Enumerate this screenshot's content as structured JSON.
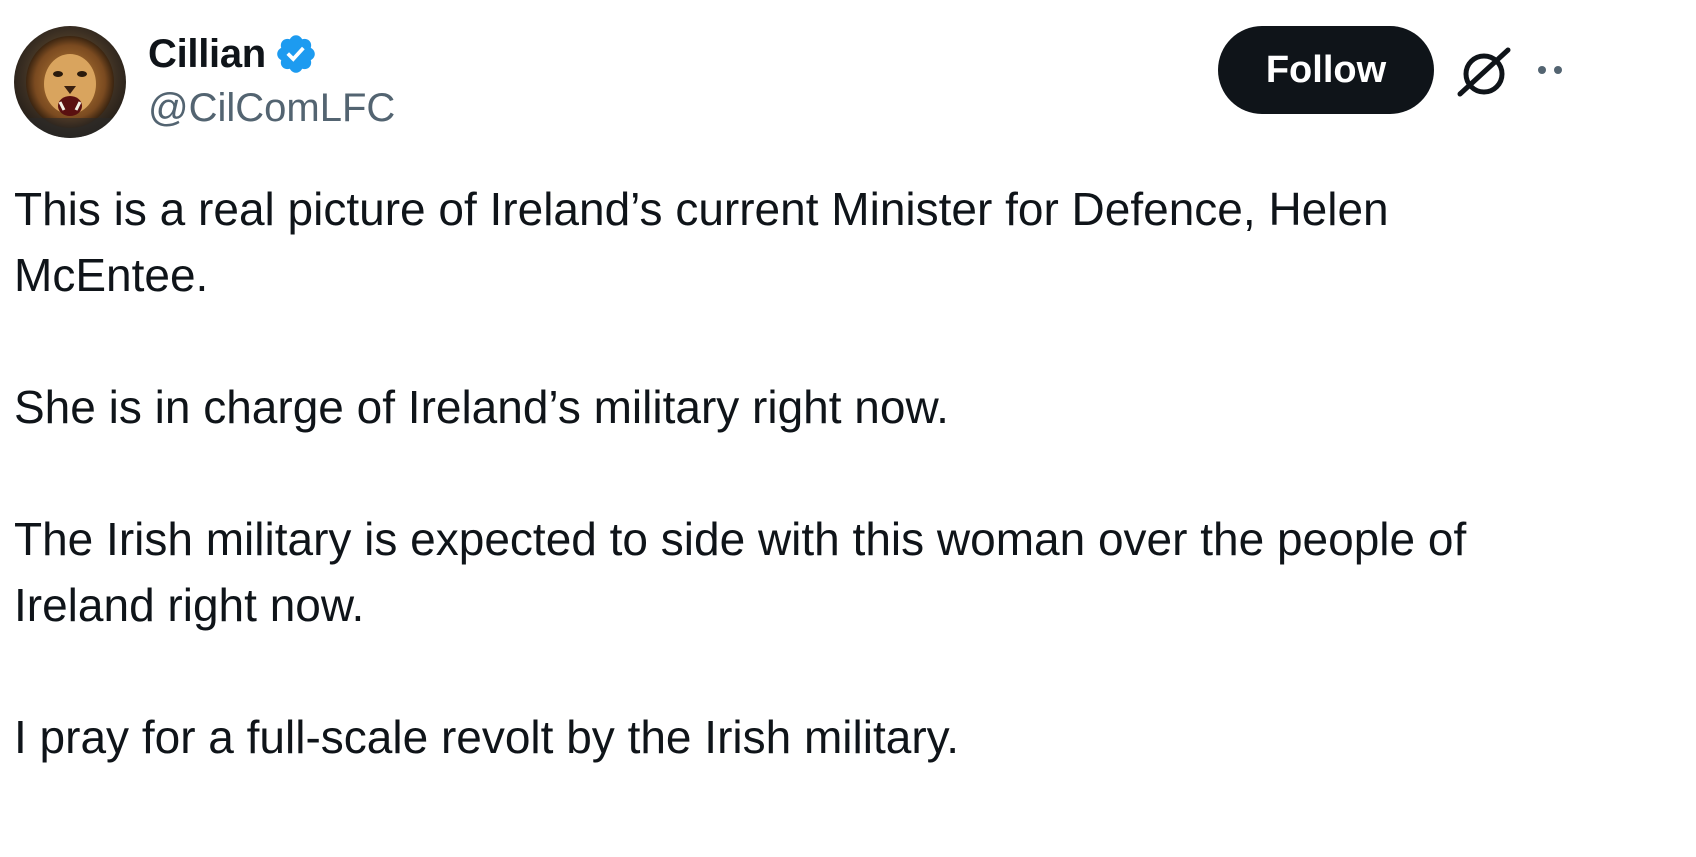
{
  "author": {
    "display_name": "Cillian",
    "handle": "@CilComLFC",
    "verified": true,
    "avatar_icon": "lion-avatar-icon",
    "verified_icon": "verified-badge-icon",
    "verified_color": "#1d9bf0"
  },
  "actions": {
    "follow_label": "Follow",
    "grok_icon": "grok-icon",
    "more_icon": "more-options-icon"
  },
  "post": {
    "paragraphs": [
      "This is a real picture of Ireland’s current Minister for Defence, Helen McEntee.",
      "She is in charge of Ireland’s military right now.",
      "The Irish military is expected to side with this woman over the people of Ireland right now.",
      "I pray for a full-scale revolt by the Irish military."
    ]
  },
  "colors": {
    "text_primary": "#0f1419",
    "text_secondary": "#536471",
    "button_bg": "#0f1419",
    "button_text": "#ffffff",
    "accent": "#1d9bf0"
  }
}
